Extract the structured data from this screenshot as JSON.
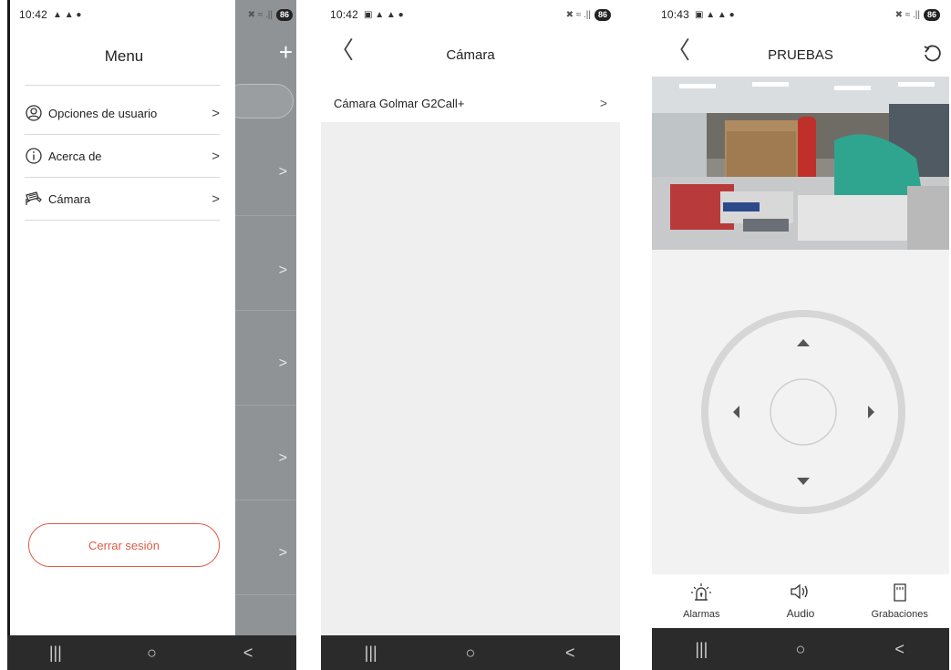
{
  "screen1": {
    "status": {
      "time": "10:42",
      "battery": "86"
    },
    "menu_title": "Menu",
    "items": [
      {
        "label": "Opciones de usuario",
        "icon": "user-circle-icon"
      },
      {
        "label": "Acerca de",
        "icon": "info-icon"
      },
      {
        "label": "Cámara",
        "icon": "cctv-camera-icon"
      }
    ],
    "logout_label": "Cerrar sesión",
    "overlay": {
      "plus": "+"
    }
  },
  "screen2": {
    "status": {
      "time": "10:42",
      "battery": "86"
    },
    "title": "Cámara",
    "items": [
      {
        "label": "Cámara Golmar G2Call+"
      }
    ]
  },
  "screen3": {
    "status": {
      "time": "10:43",
      "battery": "86"
    },
    "title": "PRUEBAS",
    "tools": [
      {
        "label": "Alarmas",
        "icon": "alarm-light-icon"
      },
      {
        "label": "Audio",
        "icon": "speaker-icon"
      },
      {
        "label": "Grabaciones",
        "icon": "sd-card-icon"
      }
    ]
  },
  "colors": {
    "accent": "#e05a47",
    "overlay": "#8f9396",
    "navbar": "#2b2b2b",
    "list_bg": "#efefef"
  }
}
